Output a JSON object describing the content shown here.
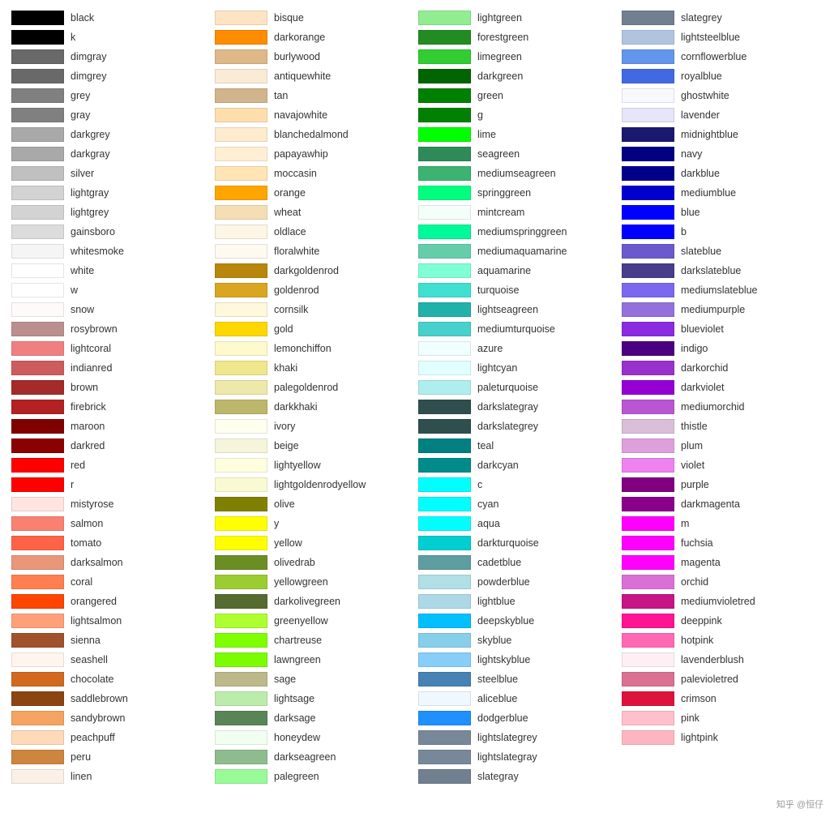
{
  "columns": [
    {
      "items": [
        {
          "name": "black",
          "color": "#000000"
        },
        {
          "name": "k",
          "color": "#000000"
        },
        {
          "name": "dimgray",
          "color": "#696969"
        },
        {
          "name": "dimgrey",
          "color": "#696969"
        },
        {
          "name": "grey",
          "color": "#808080"
        },
        {
          "name": "gray",
          "color": "#808080"
        },
        {
          "name": "darkgrey",
          "color": "#a9a9a9"
        },
        {
          "name": "darkgray",
          "color": "#a9a9a9"
        },
        {
          "name": "silver",
          "color": "#c0c0c0"
        },
        {
          "name": "lightgray",
          "color": "#d3d3d3"
        },
        {
          "name": "lightgrey",
          "color": "#d3d3d3"
        },
        {
          "name": "gainsboro",
          "color": "#dcdcdc"
        },
        {
          "name": "whitesmoke",
          "color": "#f5f5f5"
        },
        {
          "name": "white",
          "color": "#ffffff"
        },
        {
          "name": "w",
          "color": "#ffffff"
        },
        {
          "name": "snow",
          "color": "#fffafa"
        },
        {
          "name": "rosybrown",
          "color": "#bc8f8f"
        },
        {
          "name": "lightcoral",
          "color": "#f08080"
        },
        {
          "name": "indianred",
          "color": "#cd5c5c"
        },
        {
          "name": "brown",
          "color": "#a52a2a"
        },
        {
          "name": "firebrick",
          "color": "#b22222"
        },
        {
          "name": "maroon",
          "color": "#800000"
        },
        {
          "name": "darkred",
          "color": "#8b0000"
        },
        {
          "name": "red",
          "color": "#ff0000"
        },
        {
          "name": "r",
          "color": "#ff0000"
        },
        {
          "name": "mistyrose",
          "color": "#ffe4e1"
        },
        {
          "name": "salmon",
          "color": "#fa8072"
        },
        {
          "name": "tomato",
          "color": "#ff6347"
        },
        {
          "name": "darksalmon",
          "color": "#e9967a"
        },
        {
          "name": "coral",
          "color": "#ff7f50"
        },
        {
          "name": "orangered",
          "color": "#ff4500"
        },
        {
          "name": "lightsalmon",
          "color": "#ffa07a"
        },
        {
          "name": "sienna",
          "color": "#a0522d"
        },
        {
          "name": "seashell",
          "color": "#fff5ee"
        },
        {
          "name": "chocolate",
          "color": "#d2691e"
        },
        {
          "name": "saddlebrown",
          "color": "#8b4513"
        },
        {
          "name": "sandybrown",
          "color": "#f4a460"
        },
        {
          "name": "peachpuff",
          "color": "#ffdab9"
        },
        {
          "name": "peru",
          "color": "#cd853f"
        },
        {
          "name": "linen",
          "color": "#faf0e6"
        }
      ]
    },
    {
      "items": [
        {
          "name": "bisque",
          "color": "#ffe4c4"
        },
        {
          "name": "darkorange",
          "color": "#ff8c00"
        },
        {
          "name": "burlywood",
          "color": "#deb887"
        },
        {
          "name": "antiquewhite",
          "color": "#faebd7"
        },
        {
          "name": "tan",
          "color": "#d2b48c"
        },
        {
          "name": "navajowhite",
          "color": "#ffdead"
        },
        {
          "name": "blanchedalmond",
          "color": "#ffebcd"
        },
        {
          "name": "papayawhip",
          "color": "#ffefd5"
        },
        {
          "name": "moccasin",
          "color": "#ffe4b5"
        },
        {
          "name": "orange",
          "color": "#ffa500"
        },
        {
          "name": "wheat",
          "color": "#f5deb3"
        },
        {
          "name": "oldlace",
          "color": "#fdf5e6"
        },
        {
          "name": "floralwhite",
          "color": "#fffaf0"
        },
        {
          "name": "darkgoldenrod",
          "color": "#b8860b"
        },
        {
          "name": "goldenrod",
          "color": "#daa520"
        },
        {
          "name": "cornsilk",
          "color": "#fff8dc"
        },
        {
          "name": "gold",
          "color": "#ffd700"
        },
        {
          "name": "lemonchiffon",
          "color": "#fffacd"
        },
        {
          "name": "khaki",
          "color": "#f0e68c"
        },
        {
          "name": "palegoldenrod",
          "color": "#eee8aa"
        },
        {
          "name": "darkkhaki",
          "color": "#bdb76b"
        },
        {
          "name": "ivory",
          "color": "#fffff0"
        },
        {
          "name": "beige",
          "color": "#f5f5dc"
        },
        {
          "name": "lightyellow",
          "color": "#ffffe0"
        },
        {
          "name": "lightgoldenrodyellow",
          "color": "#fafad2"
        },
        {
          "name": "olive",
          "color": "#808000"
        },
        {
          "name": "y",
          "color": "#ffff00"
        },
        {
          "name": "yellow",
          "color": "#ffff00"
        },
        {
          "name": "olivedrab",
          "color": "#6b8e23"
        },
        {
          "name": "yellowgreen",
          "color": "#9acd32"
        },
        {
          "name": "darkolivegreen",
          "color": "#556b2f"
        },
        {
          "name": "greenyellow",
          "color": "#adff2f"
        },
        {
          "name": "chartreuse",
          "color": "#7fff00"
        },
        {
          "name": "lawngreen",
          "color": "#7cfc00"
        },
        {
          "name": "sage",
          "color": "#bcb88a"
        },
        {
          "name": "lightsage",
          "color": "#bcecac"
        },
        {
          "name": "darksage",
          "color": "#598556"
        },
        {
          "name": "honeydew",
          "color": "#f0fff0"
        },
        {
          "name": "darkseagreen",
          "color": "#8fbc8f"
        },
        {
          "name": "palegreen",
          "color": "#98fb98"
        }
      ]
    },
    {
      "items": [
        {
          "name": "lightgreen",
          "color": "#90ee90"
        },
        {
          "name": "forestgreen",
          "color": "#228b22"
        },
        {
          "name": "limegreen",
          "color": "#32cd32"
        },
        {
          "name": "darkgreen",
          "color": "#006400"
        },
        {
          "name": "green",
          "color": "#008000"
        },
        {
          "name": "g",
          "color": "#008000"
        },
        {
          "name": "lime",
          "color": "#00ff00"
        },
        {
          "name": "seagreen",
          "color": "#2e8b57"
        },
        {
          "name": "mediumseagreen",
          "color": "#3cb371"
        },
        {
          "name": "springgreen",
          "color": "#00ff7f"
        },
        {
          "name": "mintcream",
          "color": "#f5fffa"
        },
        {
          "name": "mediumspringgreen",
          "color": "#00fa9a"
        },
        {
          "name": "mediumaquamarine",
          "color": "#66cdaa"
        },
        {
          "name": "aquamarine",
          "color": "#7fffd4"
        },
        {
          "name": "turquoise",
          "color": "#40e0d0"
        },
        {
          "name": "lightseagreen",
          "color": "#20b2aa"
        },
        {
          "name": "mediumturquoise",
          "color": "#48d1cc"
        },
        {
          "name": "azure",
          "color": "#f0ffff"
        },
        {
          "name": "lightcyan",
          "color": "#e0ffff"
        },
        {
          "name": "paleturquoise",
          "color": "#afeeee"
        },
        {
          "name": "darkslategray",
          "color": "#2f4f4f"
        },
        {
          "name": "darkslategrey",
          "color": "#2f4f4f"
        },
        {
          "name": "teal",
          "color": "#008080"
        },
        {
          "name": "darkcyan",
          "color": "#008b8b"
        },
        {
          "name": "c",
          "color": "#00ffff"
        },
        {
          "name": "cyan",
          "color": "#00ffff"
        },
        {
          "name": "aqua",
          "color": "#00ffff"
        },
        {
          "name": "darkturquoise",
          "color": "#00ced1"
        },
        {
          "name": "cadetblue",
          "color": "#5f9ea0"
        },
        {
          "name": "powderblue",
          "color": "#b0e0e6"
        },
        {
          "name": "lightblue",
          "color": "#add8e6"
        },
        {
          "name": "deepskyblue",
          "color": "#00bfff"
        },
        {
          "name": "skyblue",
          "color": "#87ceeb"
        },
        {
          "name": "lightskyblue",
          "color": "#87cefa"
        },
        {
          "name": "steelblue",
          "color": "#4682b4"
        },
        {
          "name": "aliceblue",
          "color": "#f0f8ff"
        },
        {
          "name": "dodgerblue",
          "color": "#1e90ff"
        },
        {
          "name": "lightslategrey",
          "color": "#778899"
        },
        {
          "name": "lightslategray",
          "color": "#778899"
        },
        {
          "name": "slategray",
          "color": "#708090"
        }
      ]
    },
    {
      "items": [
        {
          "name": "slategrey",
          "color": "#708090"
        },
        {
          "name": "lightsteelblue",
          "color": "#b0c4de"
        },
        {
          "name": "cornflowerblue",
          "color": "#6495ed"
        },
        {
          "name": "royalblue",
          "color": "#4169e1"
        },
        {
          "name": "ghostwhite",
          "color": "#f8f8ff"
        },
        {
          "name": "lavender",
          "color": "#e6e6fa"
        },
        {
          "name": "midnightblue",
          "color": "#191970"
        },
        {
          "name": "navy",
          "color": "#000080"
        },
        {
          "name": "darkblue",
          "color": "#00008b"
        },
        {
          "name": "mediumblue",
          "color": "#0000cd"
        },
        {
          "name": "blue",
          "color": "#0000ff"
        },
        {
          "name": "b",
          "color": "#0000ff"
        },
        {
          "name": "slateblue",
          "color": "#6a5acd"
        },
        {
          "name": "darkslateblue",
          "color": "#483d8b"
        },
        {
          "name": "mediumslateblue",
          "color": "#7b68ee"
        },
        {
          "name": "mediumpurple",
          "color": "#9370db"
        },
        {
          "name": "blueviolet",
          "color": "#8a2be2"
        },
        {
          "name": "indigo",
          "color": "#4b0082"
        },
        {
          "name": "darkorchid",
          "color": "#9932cc"
        },
        {
          "name": "darkviolet",
          "color": "#9400d3"
        },
        {
          "name": "mediumorchid",
          "color": "#ba55d3"
        },
        {
          "name": "thistle",
          "color": "#d8bfd8"
        },
        {
          "name": "plum",
          "color": "#dda0dd"
        },
        {
          "name": "violet",
          "color": "#ee82ee"
        },
        {
          "name": "purple",
          "color": "#800080"
        },
        {
          "name": "darkmagenta",
          "color": "#8b008b"
        },
        {
          "name": "m",
          "color": "#ff00ff"
        },
        {
          "name": "fuchsia",
          "color": "#ff00ff"
        },
        {
          "name": "magenta",
          "color": "#ff00ff"
        },
        {
          "name": "orchid",
          "color": "#da70d6"
        },
        {
          "name": "mediumvioletred",
          "color": "#c71585"
        },
        {
          "name": "deeppink",
          "color": "#ff1493"
        },
        {
          "name": "hotpink",
          "color": "#ff69b4"
        },
        {
          "name": "lavenderblush",
          "color": "#fff0f5"
        },
        {
          "name": "palevioletred",
          "color": "#db7093"
        },
        {
          "name": "crimson",
          "color": "#dc143c"
        },
        {
          "name": "pink",
          "color": "#ffc0cb"
        },
        {
          "name": "lightpink",
          "color": "#ffb6c1"
        }
      ]
    }
  ],
  "watermark": "知乎 @恒仔"
}
